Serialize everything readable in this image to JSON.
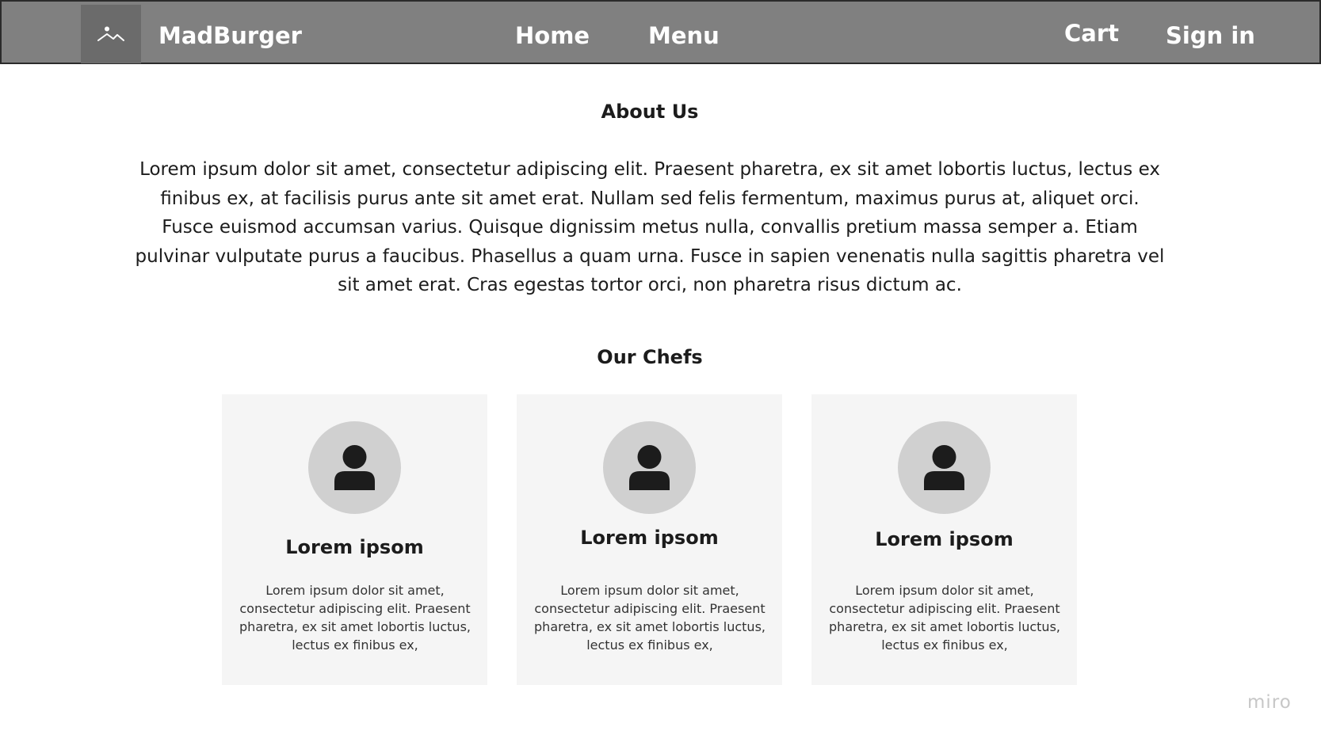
{
  "header": {
    "brand": "MadBurger",
    "nav": {
      "home": "Home",
      "menu": "Menu",
      "cart": "Cart",
      "sign_in": "Sign in"
    },
    "logo_icon": "image-placeholder-icon"
  },
  "about": {
    "title": "About Us",
    "text": "Lorem ipsum dolor sit amet, consectetur adipiscing elit. Praesent pharetra, ex sit amet lobortis luctus, lectus ex finibus ex, at facilisis purus ante sit amet erat. Nullam sed felis fermentum, maximus purus at, aliquet orci. Fusce euismod accumsan varius. Quisque dignissim metus nulla, convallis pretium massa semper a. Etiam pulvinar vulputate purus a faucibus. Phasellus a quam urna. Fusce in sapien venenatis nulla sagittis pharetra vel sit amet erat. Cras egestas tortor orci, non pharetra risus dictum ac."
  },
  "chefs": {
    "title": "Our Chefs",
    "cards": [
      {
        "name": "Lorem ipsom",
        "description": "Lorem ipsum dolor sit amet, consectetur adipiscing elit. Praesent pharetra, ex sit amet lobortis luctus, lectus ex finibus ex,"
      },
      {
        "name": "Lorem ipsom",
        "description": "Lorem ipsum dolor sit amet, consectetur adipiscing elit. Praesent pharetra, ex sit amet lobortis luctus, lectus ex finibus ex,"
      },
      {
        "name": "Lorem ipsom",
        "description": "Lorem ipsum dolor sit amet, consectetur adipiscing elit. Praesent pharetra, ex sit amet lobortis luctus, lectus ex finibus ex,"
      }
    ]
  },
  "watermark": "miro",
  "colors": {
    "navbar": "#808080",
    "logo_box": "#6b6b6b",
    "card_bg": "#f5f5f5",
    "avatar_bg": "#d0d0d0"
  }
}
